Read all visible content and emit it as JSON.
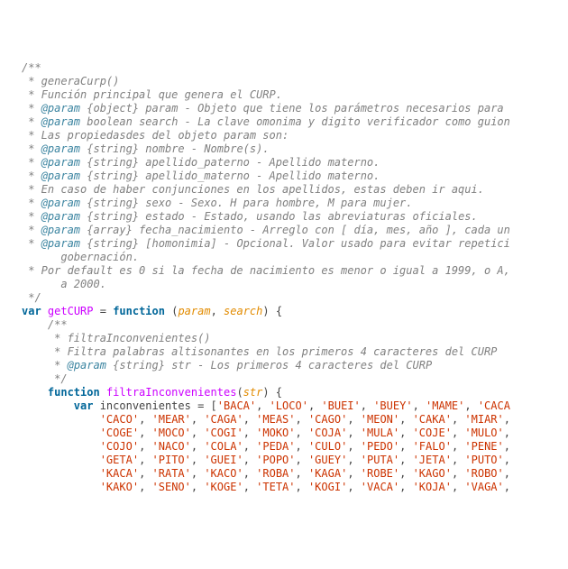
{
  "lines": [
    [
      [
        "c",
        "/**"
      ]
    ],
    [
      [
        "c",
        " * generaCurp()"
      ]
    ],
    [
      [
        "c",
        " * Función principal que genera el CURP."
      ]
    ],
    [
      [
        "c",
        " * "
      ],
      [
        "t",
        "@param"
      ],
      [
        "c",
        " {object} param - Objeto que tiene los parámetros necesarios para "
      ]
    ],
    [
      [
        "c",
        " * "
      ],
      [
        "t",
        "@param"
      ],
      [
        "c",
        " boolean search - La clave omonima y digito verificador como guion"
      ]
    ],
    [
      [
        "c",
        " * Las propiedasdes del objeto param son:"
      ]
    ],
    [
      [
        "c",
        " * "
      ],
      [
        "t",
        "@param"
      ],
      [
        "c",
        " {string} nombre - Nombre(s)."
      ]
    ],
    [
      [
        "c",
        " * "
      ],
      [
        "t",
        "@param"
      ],
      [
        "c",
        " {string} apellido_paterno - Apellido materno."
      ]
    ],
    [
      [
        "c",
        " * "
      ],
      [
        "t",
        "@param"
      ],
      [
        "c",
        " {string} apellido_materno - Apellido materno."
      ]
    ],
    [
      [
        "c",
        " * En caso de haber conjunciones en los apellidos, estas deben ir aqui."
      ]
    ],
    [
      [
        "c",
        " * "
      ],
      [
        "t",
        "@param"
      ],
      [
        "c",
        " {string} sexo - Sexo. H para hombre, M para mujer."
      ]
    ],
    [
      [
        "c",
        " * "
      ],
      [
        "t",
        "@param"
      ],
      [
        "c",
        " {string} estado - Estado, usando las abreviaturas oficiales."
      ]
    ],
    [
      [
        "c",
        " * "
      ],
      [
        "t",
        "@param"
      ],
      [
        "c",
        " {array} fecha_nacimiento - Arreglo con [ día, mes, año ], cada un"
      ]
    ],
    [
      [
        "c",
        " * "
      ],
      [
        "t",
        "@param"
      ],
      [
        "c",
        " {string} [homonimia] - Opcional. Valor usado para evitar repetici"
      ]
    ],
    [
      [
        "c",
        "      gobernación."
      ]
    ],
    [
      [
        "c",
        " * Por default es 0 si la fecha de nacimiento es menor o igual a 1999, o A,"
      ]
    ],
    [
      [
        "c",
        "      a 2000."
      ]
    ],
    [
      [
        "c",
        " */"
      ]
    ],
    [
      [
        "kw",
        "var"
      ],
      [
        "p",
        " "
      ],
      [
        "fn",
        "getCURP"
      ],
      [
        "p",
        " = "
      ],
      [
        "kw",
        "function"
      ],
      [
        "p",
        " ("
      ],
      [
        "pm",
        "param"
      ],
      [
        "p",
        ", "
      ],
      [
        "pm",
        "search"
      ],
      [
        "p",
        ") {"
      ]
    ],
    [
      [
        "p",
        "    "
      ],
      [
        "c",
        "/**"
      ]
    ],
    [
      [
        "p",
        "    "
      ],
      [
        "c",
        " * filtraInconvenientes()"
      ]
    ],
    [
      [
        "p",
        "    "
      ],
      [
        "c",
        " * Filtra palabras altisonantes en los primeros 4 caracteres del CURP"
      ]
    ],
    [
      [
        "p",
        "    "
      ],
      [
        "c",
        " * "
      ],
      [
        "t",
        "@param"
      ],
      [
        "c",
        " {string} str - Los primeros 4 caracteres del CURP"
      ]
    ],
    [
      [
        "p",
        "    "
      ],
      [
        "c",
        " */"
      ]
    ],
    [
      [
        "p",
        "    "
      ],
      [
        "kw",
        "function"
      ],
      [
        "p",
        " "
      ],
      [
        "fn",
        "filtraInconvenientes"
      ],
      [
        "p",
        "("
      ],
      [
        "pm",
        "str"
      ],
      [
        "p",
        ") {"
      ]
    ],
    [
      [
        "p",
        "        "
      ],
      [
        "kw",
        "var"
      ],
      [
        "p",
        " inconvenientes = ["
      ],
      [
        "s",
        "'BACA'"
      ],
      [
        "p",
        ", "
      ],
      [
        "s",
        "'LOCO'"
      ],
      [
        "p",
        ", "
      ],
      [
        "s",
        "'BUEI'"
      ],
      [
        "p",
        ", "
      ],
      [
        "s",
        "'BUEY'"
      ],
      [
        "p",
        ", "
      ],
      [
        "s",
        "'MAME'"
      ],
      [
        "p",
        ", "
      ],
      [
        "s",
        "'CACA"
      ]
    ],
    [
      [
        "p",
        "            "
      ],
      [
        "s",
        "'CACO'"
      ],
      [
        "p",
        ", "
      ],
      [
        "s",
        "'MEAR'"
      ],
      [
        "p",
        ", "
      ],
      [
        "s",
        "'CAGA'"
      ],
      [
        "p",
        ", "
      ],
      [
        "s",
        "'MEAS'"
      ],
      [
        "p",
        ", "
      ],
      [
        "s",
        "'CAGO'"
      ],
      [
        "p",
        ", "
      ],
      [
        "s",
        "'MEON'"
      ],
      [
        "p",
        ", "
      ],
      [
        "s",
        "'CAKA'"
      ],
      [
        "p",
        ", "
      ],
      [
        "s",
        "'MIAR'"
      ],
      [
        "p",
        ","
      ]
    ],
    [
      [
        "p",
        "            "
      ],
      [
        "s",
        "'COGE'"
      ],
      [
        "p",
        ", "
      ],
      [
        "s",
        "'MOCO'"
      ],
      [
        "p",
        ", "
      ],
      [
        "s",
        "'COGI'"
      ],
      [
        "p",
        ", "
      ],
      [
        "s",
        "'MOKO'"
      ],
      [
        "p",
        ", "
      ],
      [
        "s",
        "'COJA'"
      ],
      [
        "p",
        ", "
      ],
      [
        "s",
        "'MULA'"
      ],
      [
        "p",
        ", "
      ],
      [
        "s",
        "'COJE'"
      ],
      [
        "p",
        ", "
      ],
      [
        "s",
        "'MULO'"
      ],
      [
        "p",
        ","
      ]
    ],
    [
      [
        "p",
        "            "
      ],
      [
        "s",
        "'COJO'"
      ],
      [
        "p",
        ", "
      ],
      [
        "s",
        "'NACO'"
      ],
      [
        "p",
        ", "
      ],
      [
        "s",
        "'COLA'"
      ],
      [
        "p",
        ", "
      ],
      [
        "s",
        "'PEDA'"
      ],
      [
        "p",
        ", "
      ],
      [
        "s",
        "'CULO'"
      ],
      [
        "p",
        ", "
      ],
      [
        "s",
        "'PEDO'"
      ],
      [
        "p",
        ", "
      ],
      [
        "s",
        "'FALO'"
      ],
      [
        "p",
        ", "
      ],
      [
        "s",
        "'PENE'"
      ],
      [
        "p",
        ","
      ]
    ],
    [
      [
        "p",
        "            "
      ],
      [
        "s",
        "'GETA'"
      ],
      [
        "p",
        ", "
      ],
      [
        "s",
        "'PITO'"
      ],
      [
        "p",
        ", "
      ],
      [
        "s",
        "'GUEI'"
      ],
      [
        "p",
        ", "
      ],
      [
        "s",
        "'POPO'"
      ],
      [
        "p",
        ", "
      ],
      [
        "s",
        "'GUEY'"
      ],
      [
        "p",
        ", "
      ],
      [
        "s",
        "'PUTA'"
      ],
      [
        "p",
        ", "
      ],
      [
        "s",
        "'JETA'"
      ],
      [
        "p",
        ", "
      ],
      [
        "s",
        "'PUTO'"
      ],
      [
        "p",
        ","
      ]
    ],
    [
      [
        "p",
        "            "
      ],
      [
        "s",
        "'KACA'"
      ],
      [
        "p",
        ", "
      ],
      [
        "s",
        "'RATA'"
      ],
      [
        "p",
        ", "
      ],
      [
        "s",
        "'KACO'"
      ],
      [
        "p",
        ", "
      ],
      [
        "s",
        "'ROBA'"
      ],
      [
        "p",
        ", "
      ],
      [
        "s",
        "'KAGA'"
      ],
      [
        "p",
        ", "
      ],
      [
        "s",
        "'ROBE'"
      ],
      [
        "p",
        ", "
      ],
      [
        "s",
        "'KAGO'"
      ],
      [
        "p",
        ", "
      ],
      [
        "s",
        "'ROBO'"
      ],
      [
        "p",
        ","
      ]
    ],
    [
      [
        "p",
        "            "
      ],
      [
        "s",
        "'KAKO'"
      ],
      [
        "p",
        ", "
      ],
      [
        "s",
        "'SENO'"
      ],
      [
        "p",
        ", "
      ],
      [
        "s",
        "'KOGE'"
      ],
      [
        "p",
        ", "
      ],
      [
        "s",
        "'TETA'"
      ],
      [
        "p",
        ", "
      ],
      [
        "s",
        "'KOGI'"
      ],
      [
        "p",
        ", "
      ],
      [
        "s",
        "'VACA'"
      ],
      [
        "p",
        ", "
      ],
      [
        "s",
        "'KOJA'"
      ],
      [
        "p",
        ", "
      ],
      [
        "s",
        "'VAGA'"
      ],
      [
        "p",
        ","
      ]
    ]
  ]
}
